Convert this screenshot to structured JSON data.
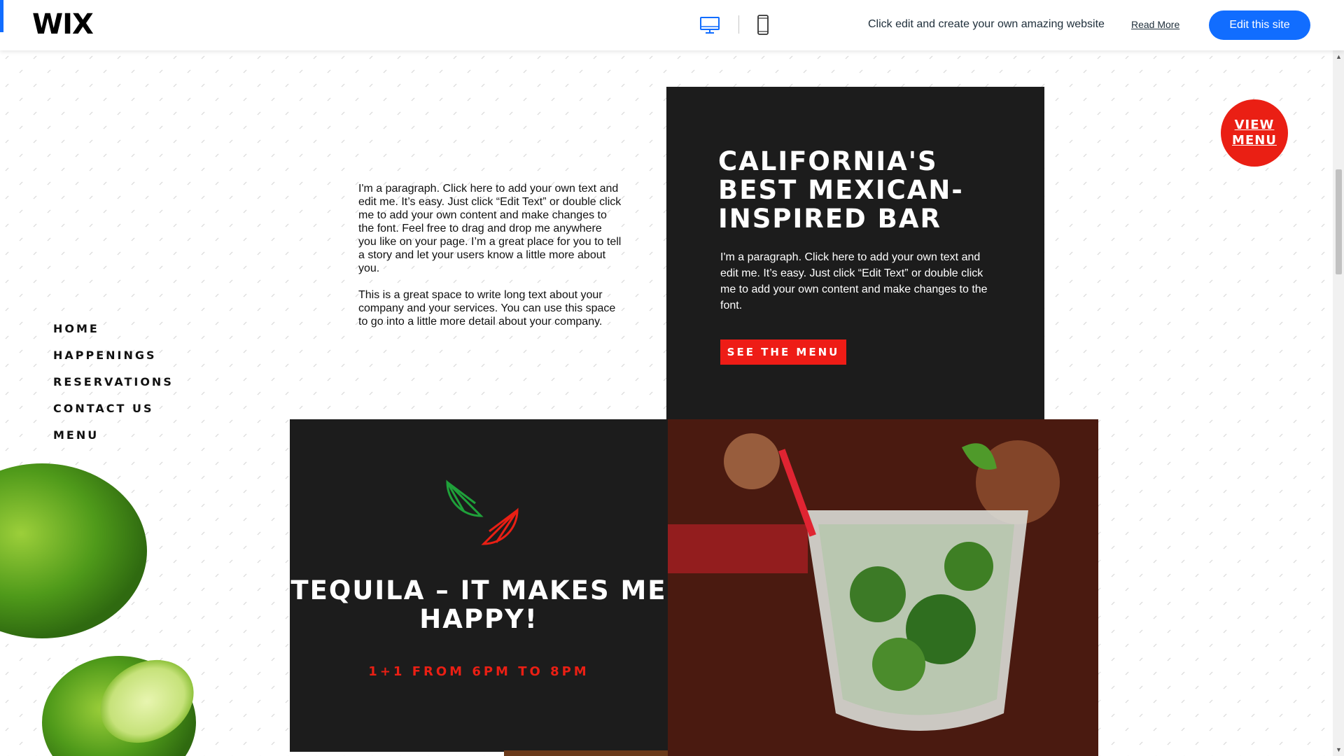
{
  "topbar": {
    "logo": "WIX",
    "promo_text": "Click edit and create your own amazing website",
    "read_more": "Read More",
    "edit_button": "Edit this site",
    "accent_color": "#116dff"
  },
  "nav": {
    "items": [
      "HOME",
      "HAPPENINGS",
      "RESERVATIONS",
      "CONTACT US",
      "MENU"
    ]
  },
  "intro": {
    "paragraph1": "I'm a paragraph. Click here to add your own text and edit me. It’s easy. Just click “Edit Text” or double click me to add your own content and make changes to the font. Feel free to drag and drop me anywhere you like on your page. I’m a great place for you to tell a story and let your users know a little more about you.",
    "paragraph2": "This is a great space to write long text about your company and your services. You can use this space to go into a little more detail about your company."
  },
  "feature": {
    "title": "CALIFORNIA'S BEST MEXICAN-INSPIRED BAR",
    "paragraph": "I'm a paragraph. Click here to add your own text and edit me. It’s easy. Just click “Edit Text” or double click me to add your own content and make changes to the font.",
    "button": "SEE THE MENU",
    "button_color": "#ee1c16"
  },
  "view_menu": {
    "line1": "VIEW",
    "line2": "MENU"
  },
  "tequila": {
    "title": "TEQUILA – IT MAKES ME HAPPY!",
    "subtitle": "1+1 FROM 6PM TO 8PM",
    "accent_color": "#ea1f14"
  },
  "icons": {
    "desktop": "desktop-icon",
    "mobile": "mobile-icon",
    "lime_slices": "lime-slices-icon"
  }
}
